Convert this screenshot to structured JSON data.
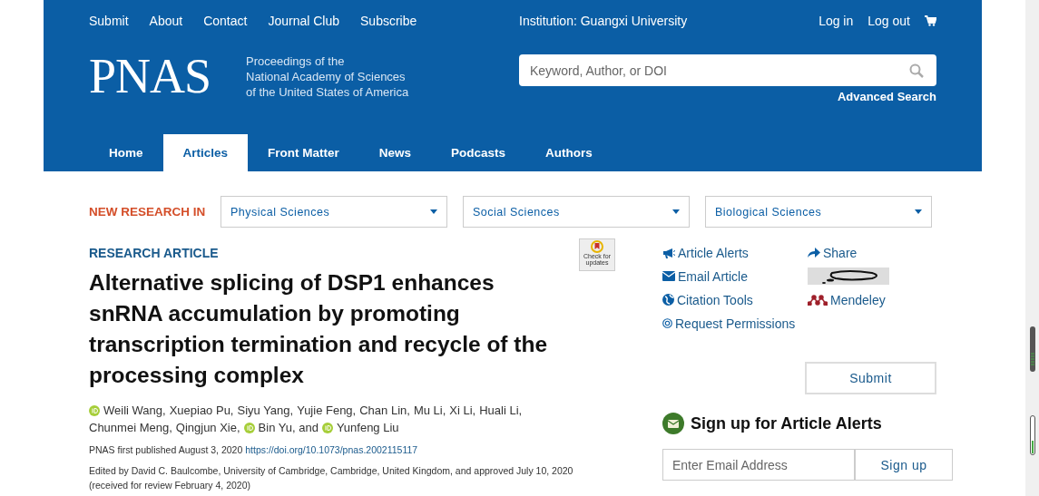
{
  "top_links": [
    "Submit",
    "About",
    "Contact",
    "Journal Club",
    "Subscribe"
  ],
  "institution": "Institution: Guangxi University",
  "account_links": [
    "Log in",
    "Log out"
  ],
  "logo": "PNAS",
  "tagline": [
    "Proceedings of the",
    "National Academy of Sciences",
    "of the United States of America"
  ],
  "search": {
    "placeholder": "Keyword, Author, or DOI"
  },
  "advanced_search": "Advanced Search",
  "tabs": [
    {
      "label": "Home",
      "selected": false
    },
    {
      "label": "Articles",
      "selected": true
    },
    {
      "label": "Front Matter",
      "selected": false
    },
    {
      "label": "News",
      "selected": false
    },
    {
      "label": "Podcasts",
      "selected": false
    },
    {
      "label": "Authors",
      "selected": false
    }
  ],
  "new_research": {
    "label": "NEW RESEARCH IN",
    "dropdowns": [
      "Physical Sciences",
      "Social Sciences",
      "Biological Sciences"
    ]
  },
  "article": {
    "type": "RESEARCH ARTICLE",
    "title": "Alternative splicing of DSP1 enhances snRNA accumulation by promoting transcription termination and recycle of the processing complex",
    "check_badge": "Check for updates",
    "authors": [
      {
        "name": "Weili Wang,",
        "orcid": true
      },
      {
        "name": "Xuepiao Pu,",
        "orcid": false
      },
      {
        "name": "Siyu Yang,",
        "orcid": false
      },
      {
        "name": "Yujie Feng,",
        "orcid": false
      },
      {
        "name": "Chan Lin,",
        "orcid": false
      },
      {
        "name": "Mu Li,",
        "orcid": false
      },
      {
        "name": "Xi Li,",
        "orcid": false
      },
      {
        "name": "Huali Li,",
        "orcid": false
      },
      {
        "name": "Chunmei Meng,",
        "orcid": false
      },
      {
        "name": "Qingjun Xie,",
        "orcid": false
      },
      {
        "name": "Bin Yu, and",
        "orcid": true
      },
      {
        "name": "Yunfeng Liu",
        "orcid": true
      }
    ],
    "published": "PNAS first published August 3, 2020",
    "doi": "https://doi.org/10.1073/pnas.2002115117",
    "edited": "Edited by David C. Baulcombe, University of Cambridge, Cambridge, United Kingdom, and approved July 10, 2020 (received for review February 4, 2020)"
  },
  "tools": [
    {
      "label": "Article Alerts",
      "kind": "megaphone"
    },
    {
      "label": "Email Article",
      "kind": "envelope"
    },
    {
      "label": "Citation Tools",
      "kind": "globe"
    },
    {
      "label": "Request Permissions",
      "kind": "copyright"
    }
  ],
  "share": [
    {
      "label": "Share",
      "kind": "share"
    },
    {
      "kind": "bubble"
    },
    {
      "label": "Mendeley",
      "kind": "mendeley"
    }
  ],
  "submit_button": "Submit",
  "alerts": {
    "heading": "Sign up for Article Alerts",
    "placeholder": "Enter Email Address",
    "button": "Sign up"
  }
}
